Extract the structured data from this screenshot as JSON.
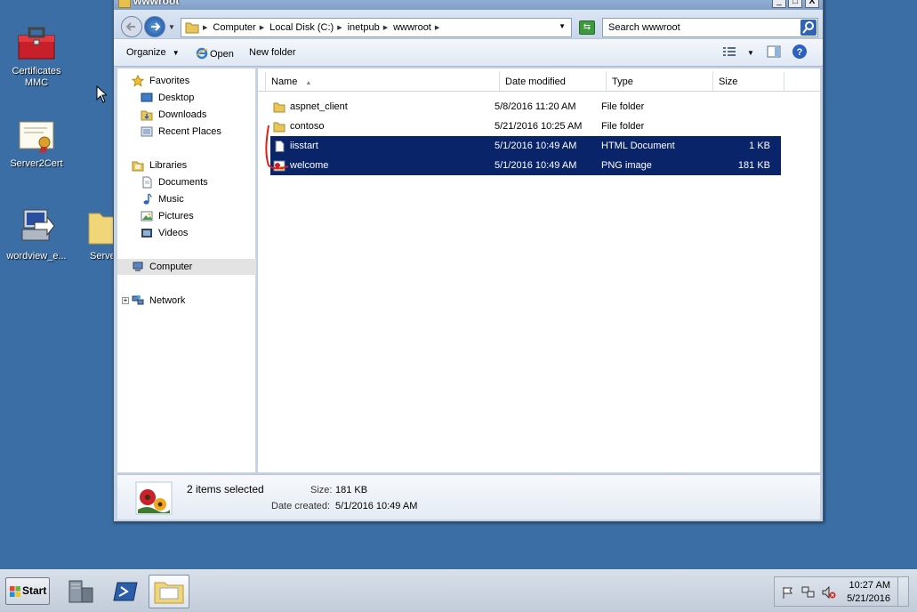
{
  "desktop": {
    "icons": [
      {
        "label": "Certificates MMC",
        "icon": "toolbox-icon"
      },
      {
        "label": "Server2Cert",
        "icon": "certificate-icon"
      },
      {
        "label": "wordview_e...",
        "icon": "installer-icon"
      },
      {
        "label": "Serve",
        "icon": "folder-icon"
      }
    ]
  },
  "window": {
    "title": "wwwroot",
    "buttons": {
      "minimize": "_",
      "maximize": "□",
      "close": "X"
    }
  },
  "address": {
    "crumbs": [
      "Computer",
      "Local Disk (C:)",
      "inetpub",
      "wwwroot"
    ],
    "search_placeholder": "Search wwwroot"
  },
  "toolbar": {
    "organize": "Organize",
    "open": "Open",
    "new_folder": "New folder"
  },
  "nav": {
    "favorites": "Favorites",
    "desktop": "Desktop",
    "downloads": "Downloads",
    "recent_places": "Recent Places",
    "libraries": "Libraries",
    "documents": "Documents",
    "music": "Music",
    "pictures": "Pictures",
    "videos": "Videos",
    "computer": "Computer",
    "network": "Network"
  },
  "columns": {
    "name": "Name",
    "date": "Date modified",
    "type": "Type",
    "size": "Size"
  },
  "files": [
    {
      "name": "aspnet_client",
      "date": "5/8/2016 11:20 AM",
      "type": "File folder",
      "size": "",
      "selected": false,
      "icon": "folder-icon"
    },
    {
      "name": "contoso",
      "date": "5/21/2016 10:25 AM",
      "type": "File folder",
      "size": "",
      "selected": false,
      "icon": "folder-icon"
    },
    {
      "name": "iisstart",
      "date": "5/1/2016 10:49 AM",
      "type": "HTML Document",
      "size": "1 KB",
      "selected": true,
      "icon": "html-file-icon"
    },
    {
      "name": "welcome",
      "date": "5/1/2016 10:49 AM",
      "type": "PNG image",
      "size": "181 KB",
      "selected": true,
      "icon": "image-file-icon"
    }
  ],
  "details": {
    "selection": "2 items selected",
    "size_label": "Size:",
    "size_value": "181 KB",
    "created_label": "Date created:",
    "created_value": "5/1/2016 10:49 AM"
  },
  "taskbar": {
    "start": "Start",
    "time": "10:27 AM",
    "date": "5/21/2016"
  },
  "colors": {
    "desktop": "#3a6ea5",
    "selection": "#0a246a",
    "annotation": "#e0201b"
  }
}
